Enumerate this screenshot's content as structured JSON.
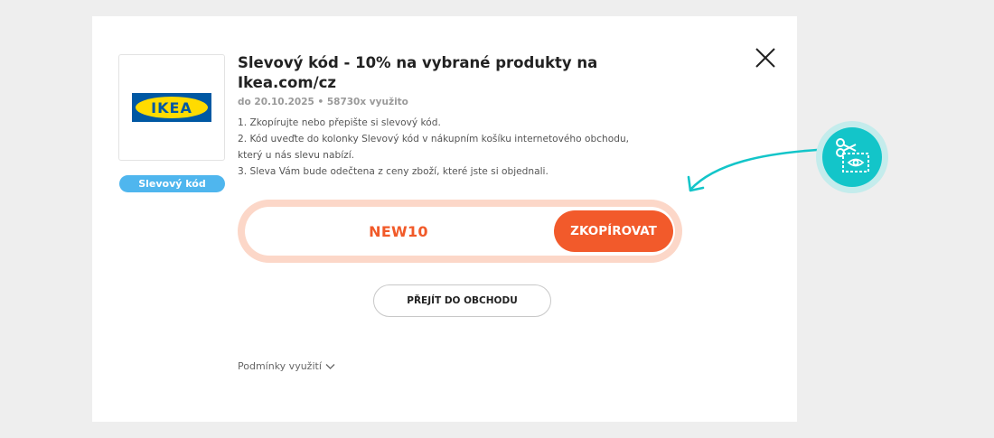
{
  "offer": {
    "title": "Slevový kód - 10% na vybrané produkty na Ikea.com/cz",
    "meta": "do 20.10.2025 • 58730x využito",
    "steps": [
      "1. Zkopírujte nebo přepište si slevový kód.",
      "2. Kód uveďte do kolonky Slevový kód v nákupním košíku internetového obchodu, který u nás slevu nabízí.",
      "3. Sleva Vám bude odečtena z ceny zboží, které jste si objednali."
    ],
    "badge": "Slevový kód"
  },
  "logo": {
    "text": "IKEA",
    "brand_blue": "#0058a3",
    "brand_yellow": "#ffdb00"
  },
  "code": {
    "value": "NEW10",
    "copy_label": "ZKOPÍROVAT"
  },
  "shop_button": {
    "label": "PŘEJÍT DO OBCHODU"
  },
  "terms": {
    "label": "Podmínky využití"
  },
  "icons": {
    "close": "close-icon",
    "terms_chevron": "chevron-down-icon",
    "tip": "scissors-coupon-icon",
    "arrow": "curved-arrow-icon"
  },
  "colors": {
    "accent": "#f25a2b",
    "badge": "#4fb6ee",
    "teal": "#13c5c9"
  }
}
